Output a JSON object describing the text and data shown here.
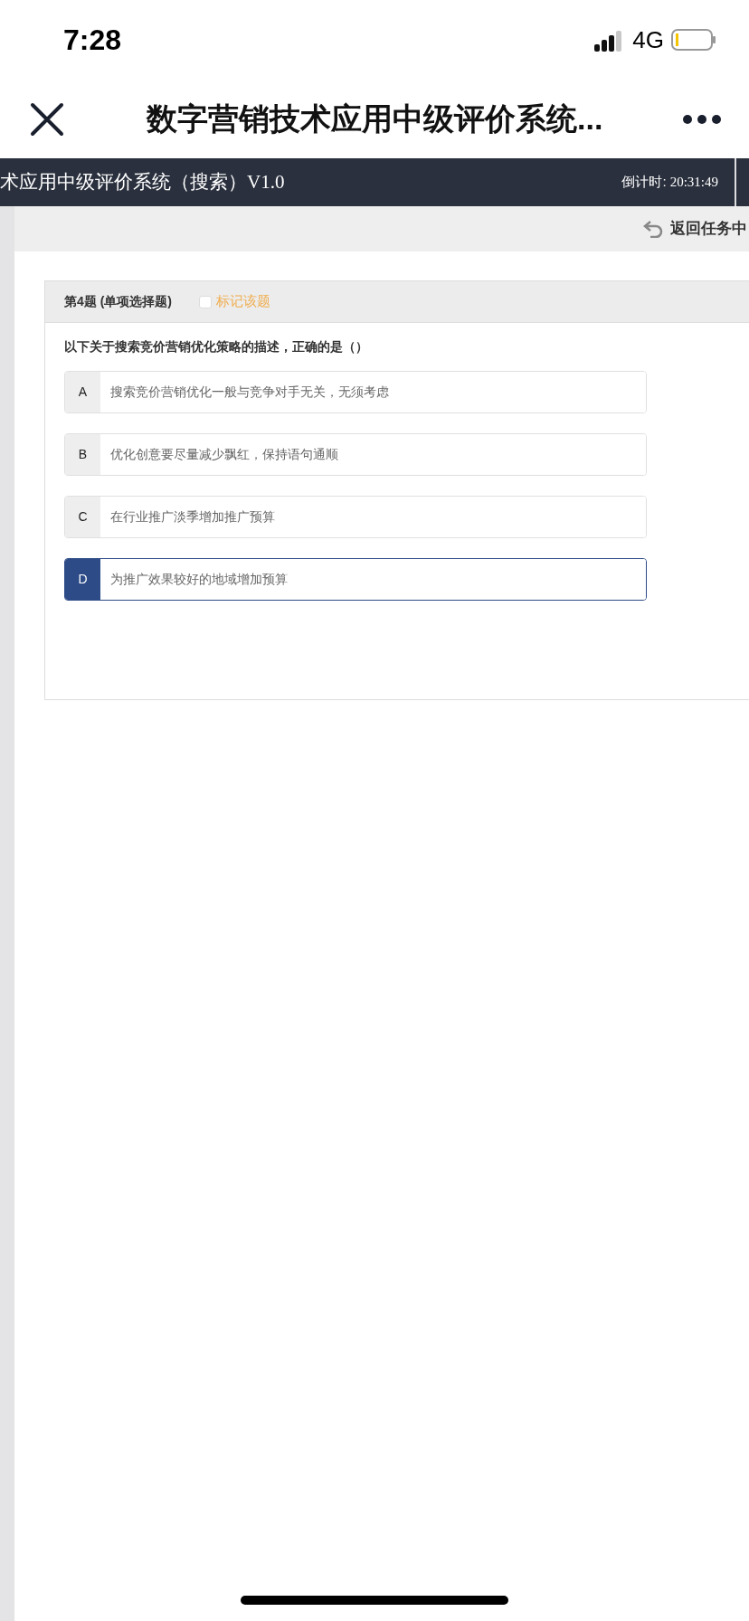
{
  "status_bar": {
    "time": "7:28",
    "network": "4G"
  },
  "nav_bar": {
    "title": "数字营销技术应用中级评价系统..."
  },
  "header": {
    "title": "术应用中级评价系统（搜索）V1.0",
    "timer_label": "倒计时:",
    "timer": "20:31:49"
  },
  "toolbar": {
    "back_label": "返回任务中"
  },
  "question": {
    "heading": "第4题 (单项选择题)",
    "mark": {
      "label": "标记该题",
      "checked": false
    },
    "text": "以下关于搜索竞价营销优化策略的描述，正确的是（）",
    "options": [
      {
        "letter": "A",
        "text": "搜索竞价营销优化一般与竞争对手无关，无须考虑",
        "selected": false
      },
      {
        "letter": "B",
        "text": "优化创意要尽量减少飘红，保持语句通顺",
        "selected": false
      },
      {
        "letter": "C",
        "text": "在行业推广淡季增加推广预算",
        "selected": false
      },
      {
        "letter": "D",
        "text": "为推广效果较好的地域增加预算",
        "selected": true
      }
    ]
  }
}
